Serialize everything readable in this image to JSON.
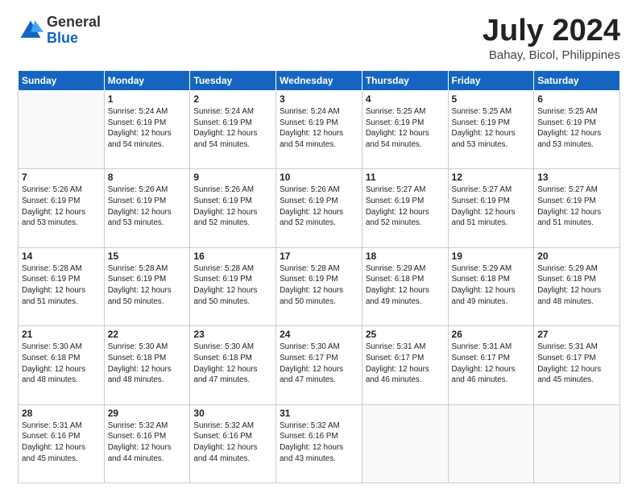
{
  "logo": {
    "general": "General",
    "blue": "Blue"
  },
  "title": "July 2024",
  "location": "Bahay, Bicol, Philippines",
  "days_of_week": [
    "Sunday",
    "Monday",
    "Tuesday",
    "Wednesday",
    "Thursday",
    "Friday",
    "Saturday"
  ],
  "weeks": [
    [
      {
        "day": "",
        "sunrise": "",
        "sunset": "",
        "daylight": ""
      },
      {
        "day": "1",
        "sunrise": "Sunrise: 5:24 AM",
        "sunset": "Sunset: 6:19 PM",
        "daylight": "Daylight: 12 hours and 54 minutes."
      },
      {
        "day": "2",
        "sunrise": "Sunrise: 5:24 AM",
        "sunset": "Sunset: 6:19 PM",
        "daylight": "Daylight: 12 hours and 54 minutes."
      },
      {
        "day": "3",
        "sunrise": "Sunrise: 5:24 AM",
        "sunset": "Sunset: 6:19 PM",
        "daylight": "Daylight: 12 hours and 54 minutes."
      },
      {
        "day": "4",
        "sunrise": "Sunrise: 5:25 AM",
        "sunset": "Sunset: 6:19 PM",
        "daylight": "Daylight: 12 hours and 54 minutes."
      },
      {
        "day": "5",
        "sunrise": "Sunrise: 5:25 AM",
        "sunset": "Sunset: 6:19 PM",
        "daylight": "Daylight: 12 hours and 53 minutes."
      },
      {
        "day": "6",
        "sunrise": "Sunrise: 5:25 AM",
        "sunset": "Sunset: 6:19 PM",
        "daylight": "Daylight: 12 hours and 53 minutes."
      }
    ],
    [
      {
        "day": "7",
        "sunrise": "Sunrise: 5:26 AM",
        "sunset": "Sunset: 6:19 PM",
        "daylight": "Daylight: 12 hours and 53 minutes."
      },
      {
        "day": "8",
        "sunrise": "Sunrise: 5:26 AM",
        "sunset": "Sunset: 6:19 PM",
        "daylight": "Daylight: 12 hours and 53 minutes."
      },
      {
        "day": "9",
        "sunrise": "Sunrise: 5:26 AM",
        "sunset": "Sunset: 6:19 PM",
        "daylight": "Daylight: 12 hours and 52 minutes."
      },
      {
        "day": "10",
        "sunrise": "Sunrise: 5:26 AM",
        "sunset": "Sunset: 6:19 PM",
        "daylight": "Daylight: 12 hours and 52 minutes."
      },
      {
        "day": "11",
        "sunrise": "Sunrise: 5:27 AM",
        "sunset": "Sunset: 6:19 PM",
        "daylight": "Daylight: 12 hours and 52 minutes."
      },
      {
        "day": "12",
        "sunrise": "Sunrise: 5:27 AM",
        "sunset": "Sunset: 6:19 PM",
        "daylight": "Daylight: 12 hours and 51 minutes."
      },
      {
        "day": "13",
        "sunrise": "Sunrise: 5:27 AM",
        "sunset": "Sunset: 6:19 PM",
        "daylight": "Daylight: 12 hours and 51 minutes."
      }
    ],
    [
      {
        "day": "14",
        "sunrise": "Sunrise: 5:28 AM",
        "sunset": "Sunset: 6:19 PM",
        "daylight": "Daylight: 12 hours and 51 minutes."
      },
      {
        "day": "15",
        "sunrise": "Sunrise: 5:28 AM",
        "sunset": "Sunset: 6:19 PM",
        "daylight": "Daylight: 12 hours and 50 minutes."
      },
      {
        "day": "16",
        "sunrise": "Sunrise: 5:28 AM",
        "sunset": "Sunset: 6:19 PM",
        "daylight": "Daylight: 12 hours and 50 minutes."
      },
      {
        "day": "17",
        "sunrise": "Sunrise: 5:28 AM",
        "sunset": "Sunset: 6:19 PM",
        "daylight": "Daylight: 12 hours and 50 minutes."
      },
      {
        "day": "18",
        "sunrise": "Sunrise: 5:29 AM",
        "sunset": "Sunset: 6:18 PM",
        "daylight": "Daylight: 12 hours and 49 minutes."
      },
      {
        "day": "19",
        "sunrise": "Sunrise: 5:29 AM",
        "sunset": "Sunset: 6:18 PM",
        "daylight": "Daylight: 12 hours and 49 minutes."
      },
      {
        "day": "20",
        "sunrise": "Sunrise: 5:29 AM",
        "sunset": "Sunset: 6:18 PM",
        "daylight": "Daylight: 12 hours and 48 minutes."
      }
    ],
    [
      {
        "day": "21",
        "sunrise": "Sunrise: 5:30 AM",
        "sunset": "Sunset: 6:18 PM",
        "daylight": "Daylight: 12 hours and 48 minutes."
      },
      {
        "day": "22",
        "sunrise": "Sunrise: 5:30 AM",
        "sunset": "Sunset: 6:18 PM",
        "daylight": "Daylight: 12 hours and 48 minutes."
      },
      {
        "day": "23",
        "sunrise": "Sunrise: 5:30 AM",
        "sunset": "Sunset: 6:18 PM",
        "daylight": "Daylight: 12 hours and 47 minutes."
      },
      {
        "day": "24",
        "sunrise": "Sunrise: 5:30 AM",
        "sunset": "Sunset: 6:17 PM",
        "daylight": "Daylight: 12 hours and 47 minutes."
      },
      {
        "day": "25",
        "sunrise": "Sunrise: 5:31 AM",
        "sunset": "Sunset: 6:17 PM",
        "daylight": "Daylight: 12 hours and 46 minutes."
      },
      {
        "day": "26",
        "sunrise": "Sunrise: 5:31 AM",
        "sunset": "Sunset: 6:17 PM",
        "daylight": "Daylight: 12 hours and 46 minutes."
      },
      {
        "day": "27",
        "sunrise": "Sunrise: 5:31 AM",
        "sunset": "Sunset: 6:17 PM",
        "daylight": "Daylight: 12 hours and 45 minutes."
      }
    ],
    [
      {
        "day": "28",
        "sunrise": "Sunrise: 5:31 AM",
        "sunset": "Sunset: 6:16 PM",
        "daylight": "Daylight: 12 hours and 45 minutes."
      },
      {
        "day": "29",
        "sunrise": "Sunrise: 5:32 AM",
        "sunset": "Sunset: 6:16 PM",
        "daylight": "Daylight: 12 hours and 44 minutes."
      },
      {
        "day": "30",
        "sunrise": "Sunrise: 5:32 AM",
        "sunset": "Sunset: 6:16 PM",
        "daylight": "Daylight: 12 hours and 44 minutes."
      },
      {
        "day": "31",
        "sunrise": "Sunrise: 5:32 AM",
        "sunset": "Sunset: 6:16 PM",
        "daylight": "Daylight: 12 hours and 43 minutes."
      },
      {
        "day": "",
        "sunrise": "",
        "sunset": "",
        "daylight": ""
      },
      {
        "day": "",
        "sunrise": "",
        "sunset": "",
        "daylight": ""
      },
      {
        "day": "",
        "sunrise": "",
        "sunset": "",
        "daylight": ""
      }
    ]
  ]
}
